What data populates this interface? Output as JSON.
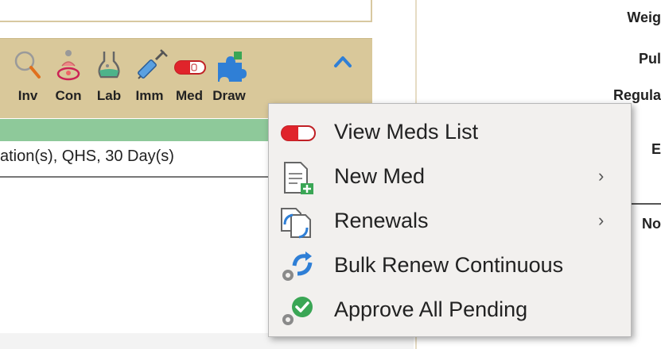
{
  "toolbar": {
    "items": [
      {
        "label": "Inv",
        "icon": "magnifier-icon"
      },
      {
        "label": "Con",
        "icon": "consult-icon"
      },
      {
        "label": "Lab",
        "icon": "flask-icon"
      },
      {
        "label": "Imm",
        "icon": "syringe-icon"
      },
      {
        "label": "Med",
        "icon": "pill-icon"
      },
      {
        "label": "Draw",
        "icon": "puzzle-icon"
      }
    ],
    "collapse_icon": "chevron-up-icon"
  },
  "medication_row": {
    "text": "ation(s), QHS, 30 Day(s)"
  },
  "vitals": {
    "weight_label": "Weig",
    "pulse_label": "Pul",
    "regular_label": "Regula",
    "b_label": "E",
    "no_label": "No"
  },
  "context_menu": {
    "items": [
      {
        "label": "View Meds List",
        "icon": "pill-icon",
        "submenu": false
      },
      {
        "label": "New Med",
        "icon": "new-document-icon",
        "submenu": true
      },
      {
        "label": "Renewals",
        "icon": "renew-documents-icon",
        "submenu": true
      },
      {
        "label": "Bulk Renew Continuous",
        "icon": "bulk-renew-icon",
        "submenu": false
      },
      {
        "label": "Approve All Pending",
        "icon": "approve-icon",
        "submenu": false
      }
    ],
    "submenu_glyph": "›"
  },
  "colors": {
    "toolbar_bg": "#d9c89a",
    "status_bar": "#8ec99a",
    "menu_bg": "#f2f0ee",
    "pill_red": "#e0242b",
    "accent_blue": "#2f7fd6",
    "approve_green": "#3aa655"
  }
}
